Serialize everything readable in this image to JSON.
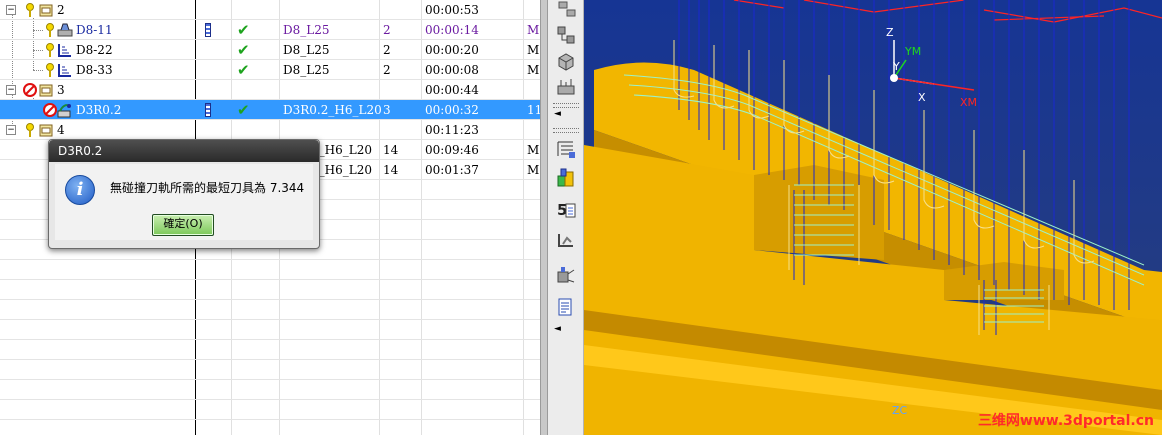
{
  "navigator": {
    "rows": [
      {
        "name": "2",
        "tool": "",
        "path": "",
        "time": "00:00:53",
        "extra": "",
        "checked": false,
        "status": "ok"
      },
      {
        "name": "D8-11",
        "tool": "D8_L25",
        "path": "2",
        "time": "00:00:14",
        "extra": "M",
        "checked": true,
        "status": "ok"
      },
      {
        "name": "D8-22",
        "tool": "D8_L25",
        "path": "2",
        "time": "00:00:20",
        "extra": "M",
        "checked": true,
        "status": "ok"
      },
      {
        "name": "D8-33",
        "tool": "D8_L25",
        "path": "2",
        "time": "00:00:08",
        "extra": "M",
        "checked": true,
        "status": "ok"
      },
      {
        "name": "3",
        "tool": "",
        "path": "",
        "time": "00:00:44",
        "extra": "",
        "checked": false,
        "status": "stop"
      },
      {
        "name": "D3R0.2",
        "tool": "D3R0.2_H6_L20",
        "path": "3",
        "time": "00:00:32",
        "extra": "11",
        "checked": true,
        "status": "stop"
      },
      {
        "name": "4",
        "tool": "",
        "path": "",
        "time": "00:11:23",
        "extra": "",
        "checked": false,
        "status": "ok"
      },
      {
        "name": "",
        "tool": "2_H6_L20",
        "path": "14",
        "time": "00:09:46",
        "extra": "M",
        "checked": false,
        "status": "ok"
      },
      {
        "name": "",
        "tool": "2_H6_L20",
        "path": "14",
        "time": "00:01:37",
        "extra": "M",
        "checked": false,
        "status": "ok"
      }
    ]
  },
  "dialog": {
    "title": "D3R0.2",
    "message": "無碰撞刀軌所需的最短刀具為 7.344",
    "ok_label": "確定(O)"
  },
  "graphics": {
    "axes": {
      "z": "Z",
      "ym": "YM",
      "y": "Y",
      "x": "X",
      "xm": "XM",
      "zc": "ZC"
    },
    "watermark": "三维网www.3dportal.cn",
    "colors": {
      "background": "#1f3a8f",
      "part": "#f0b400",
      "part_dark": "#b07c00",
      "toolpath_cut": "#9cf2c8",
      "toolpath_move": "#f5d060",
      "engage": "#1a2acc",
      "rapid": "#ff2020"
    }
  }
}
